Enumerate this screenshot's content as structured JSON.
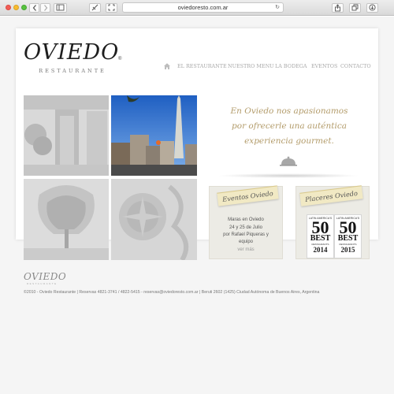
{
  "browser": {
    "url": "oviedoresto.com.ar",
    "back_icon": "chevron-left-icon",
    "forward_icon": "chevron-right-icon",
    "sidebar_icon": "sidebar-icon",
    "reload_icon": "reload-icon",
    "share_icon": "share-icon",
    "tabs_icon": "tabs-icon",
    "download_icon": "download-icon",
    "new_tab_icon": "plus-icon"
  },
  "logo": {
    "title": "OVIEDO",
    "registered": "®",
    "subtitle": "RESTAURANTE"
  },
  "nav": {
    "home_icon": "home-icon",
    "items": [
      "EL RESTAURANTE",
      "NUESTRO MENU",
      "LA BODEGA",
      "EVENTOS",
      "CONTACTO"
    ]
  },
  "hero": {
    "quote_lines": [
      "En Oviedo nos apasionamos",
      "por ofrecerle una auténtica",
      "experiencia gourmet."
    ],
    "quote_icon": "cloche-icon"
  },
  "events_card": {
    "tag": "Eventos Oviedo",
    "title": "Maras en Oviedo",
    "lines": [
      "24 y 25 de Julio",
      "por Rafael Piqueras y",
      "equipo"
    ],
    "more": "ver más"
  },
  "pleasures_card": {
    "tag": "Placeres Oviedo",
    "awards": [
      {
        "top": "LATIN AMERICA'S",
        "number": "50",
        "best": "BEST",
        "rest": "RESTAURANTS",
        "year": "2014"
      },
      {
        "top": "LATIN AMERICA'S",
        "number": "50",
        "best": "BEST",
        "rest": "RESTAURANTS",
        "year": "2015"
      }
    ]
  },
  "footer": {
    "logo": "OVIEDO",
    "logo_sub": "RESTAURANTE",
    "line": "©2010 - Oviedo Restaurante | Reservas 4821-3741 / 4822-5415 - reservas@oviedoresto.com.ar | Beruti 2602 (1425) Ciudad Autónoma de Buenos Aires, Argentina"
  },
  "colors": {
    "gold": "#b39c6b",
    "tag_yellow": "#f1e9c4",
    "nav_gray": "#a8a8a8"
  }
}
